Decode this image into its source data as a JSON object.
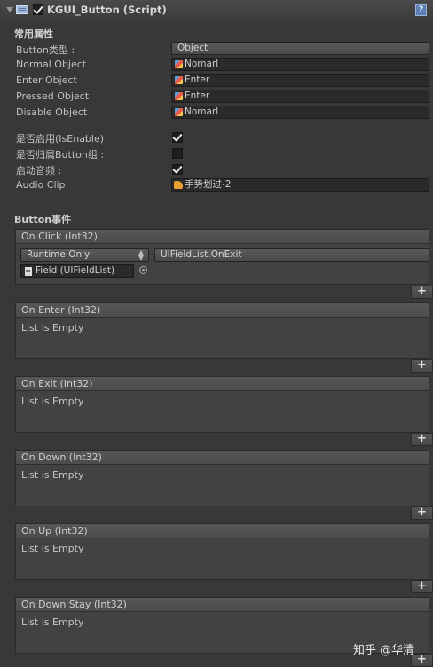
{
  "header": {
    "title": "KGUI_Button (Script)"
  },
  "common": {
    "section_title": "常用属性",
    "props": [
      {
        "label": "Button类型 :",
        "kind": "dropdown",
        "value": "Object"
      },
      {
        "label": "Normal Object",
        "kind": "object",
        "value": "Nomarl"
      },
      {
        "label": "Enter Object",
        "kind": "object",
        "value": "Enter"
      },
      {
        "label": "Pressed Object",
        "kind": "object",
        "value": "Enter"
      },
      {
        "label": "Disable Object",
        "kind": "object",
        "value": "Nomarl"
      }
    ],
    "toggles": [
      {
        "label": "是否启用(IsEnable)",
        "checked": true
      },
      {
        "label": "是否归属Button组 :",
        "checked": false
      },
      {
        "label": "启动音频 :",
        "checked": true
      }
    ],
    "audio": {
      "label": "Audio Clip",
      "value": "手势划过-2"
    }
  },
  "events": {
    "section_title": "Button事件",
    "empty_text": "List is Empty",
    "add_label": "+",
    "on_click": {
      "title": "On Click (Int32)",
      "mode": "Runtime Only",
      "function": "UIFieldList.OnExit",
      "target": "Field (UIFieldList)"
    },
    "others": [
      {
        "title": "On Enter (Int32)"
      },
      {
        "title": "On Exit (Int32)"
      },
      {
        "title": "On Down (Int32)"
      },
      {
        "title": "On Up (Int32)"
      },
      {
        "title": "On Down Stay (Int32)"
      }
    ]
  },
  "watermark": "知乎 @华清"
}
